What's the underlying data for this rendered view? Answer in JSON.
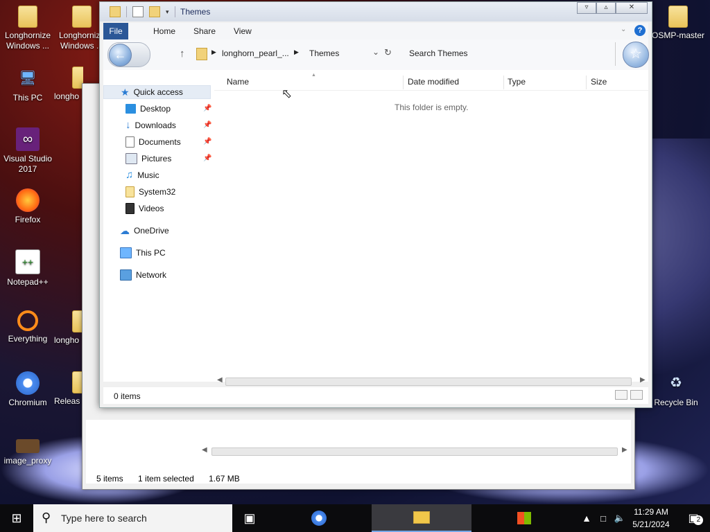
{
  "desktop": {
    "icons_left": [
      {
        "label": "Longhornize Windows ..."
      },
      {
        "label": "Longhornize Windows ..."
      },
      {
        "label": "This PC"
      },
      {
        "label": "longho"
      },
      {
        "label": "Visual Studio 2017"
      },
      {
        "label": "Firefox"
      },
      {
        "label": "Notepad++"
      },
      {
        "label": "Everything"
      },
      {
        "label": "longho"
      },
      {
        "label": "Chromium"
      },
      {
        "label": "Releas"
      },
      {
        "label": "image_proxy"
      }
    ],
    "icons_right": [
      {
        "label": "OSMP-master"
      },
      {
        "label": "Recycle Bin"
      }
    ]
  },
  "window": {
    "title": "Themes",
    "ribbon_tabs": [
      "File",
      "Home",
      "Share",
      "View"
    ],
    "help_icon": "?",
    "breadcrumb": [
      "longhorn_pearl_...",
      "Themes"
    ],
    "search_placeholder": "Search Themes",
    "nav": {
      "quick_access": "Quick access",
      "items": [
        "Desktop",
        "Downloads",
        "Documents",
        "Pictures",
        "Music",
        "System32",
        "Videos"
      ],
      "onedrive": "OneDrive",
      "this_pc": "This PC",
      "network": "Network"
    },
    "columns": [
      "Name",
      "Date modified",
      "Type",
      "Size"
    ],
    "empty_message": "This folder is empty.",
    "status": "0 items"
  },
  "background_window": {
    "status_items": "5 items",
    "status_selected": "1 item selected",
    "status_size": "1.67 MB"
  },
  "taskbar": {
    "search_placeholder": "Type here to search",
    "time": "11:29 AM",
    "date": "5/21/2024",
    "notification_count": "2"
  }
}
